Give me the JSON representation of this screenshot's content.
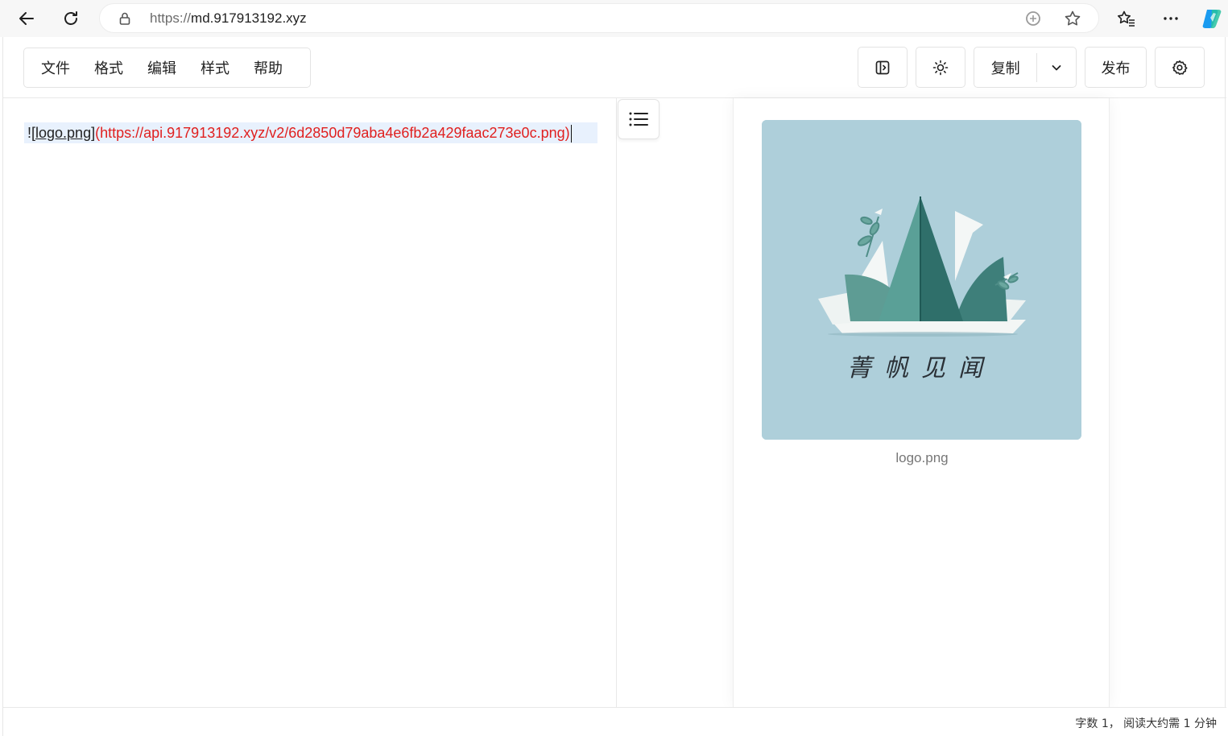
{
  "browser": {
    "url_scheme": "https://",
    "url_host": "md.917913192.xyz"
  },
  "menu": {
    "items": [
      {
        "label": "文件"
      },
      {
        "label": "格式"
      },
      {
        "label": "编辑"
      },
      {
        "label": "样式"
      },
      {
        "label": "帮助"
      }
    ]
  },
  "toolbar": {
    "copy_label": "复制",
    "publish_label": "发布"
  },
  "editor": {
    "mark_open": "![",
    "alt_text": "logo.png",
    "mark_close": "]",
    "url_text": "(https://api.917913192.xyz/v2/6d2850d79aba4e6fb2a429faac273e0c.png)"
  },
  "preview": {
    "image_text": "菁帆见闻",
    "caption": "logo.png"
  },
  "status": {
    "text": "字数 1， 阅读大约需 1 分钟"
  },
  "colors": {
    "url_red": "#e0201f",
    "image_bg": "#aecfda",
    "leaf_dark": "#3e7f7a"
  }
}
